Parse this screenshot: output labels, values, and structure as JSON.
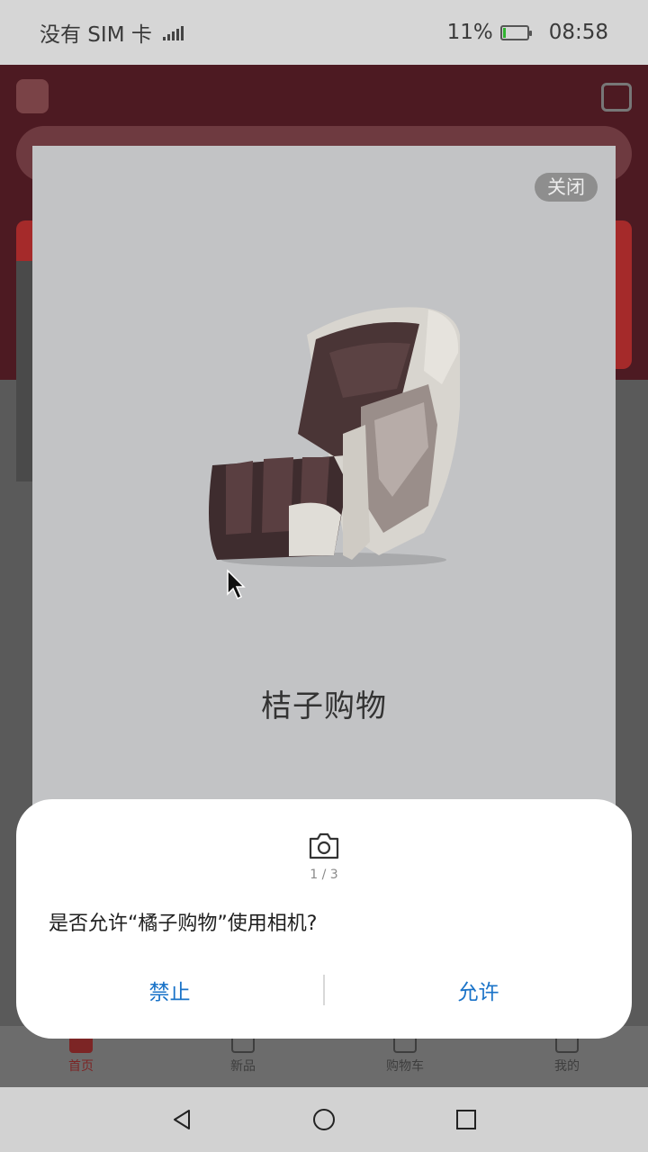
{
  "status_bar": {
    "carrier": "没有 SIM 卡",
    "battery_percent": "11%",
    "battery_level": 0.11,
    "time": "08:58"
  },
  "ad": {
    "close_label": "关闭",
    "product_icon": "massage-chair-image",
    "title": "桔子购物"
  },
  "dialog": {
    "icon": "camera-icon",
    "page_indicator": "1 / 3",
    "question": "是否允许“橘子购物”使用相机?",
    "deny_label": "禁止",
    "allow_label": "允许"
  },
  "tab_bar": {
    "items": [
      {
        "label": "首页"
      },
      {
        "label": "新品"
      },
      {
        "label": "购物车"
      },
      {
        "label": "我的"
      }
    ]
  },
  "nav_bar": {
    "back_icon": "back-icon",
    "home_icon": "home-icon",
    "recents_icon": "recents-icon"
  },
  "colors": {
    "accent": "#1a73c8",
    "brand": "#7c2525"
  }
}
